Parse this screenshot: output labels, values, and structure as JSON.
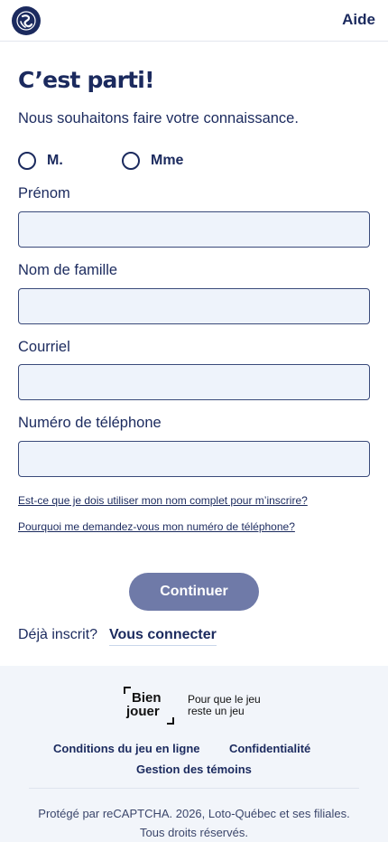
{
  "header": {
    "help_label": "Aide"
  },
  "form": {
    "title": "C’est parti!",
    "subtitle": "Nous souhaitons faire votre connaissance.",
    "salutation": {
      "option_m": "M.",
      "option_mme": "Mme",
      "selected": null
    },
    "fields": {
      "first_name_label": "Prénom",
      "last_name_label": "Nom de famille",
      "email_label": "Courriel",
      "phone_label": "Numéro de téléphone",
      "first_name_value": "",
      "last_name_value": "",
      "email_value": "",
      "phone_value": ""
    },
    "help_full_name": "Est-ce que je dois utiliser mon nom complet pour m’inscrire?",
    "help_phone": "Pourquoi me demandez-vous mon numéro de téléphone?",
    "continue_label": "Continuer",
    "already_registered": "Déjà inscrit?",
    "login_label": "Vous connecter"
  },
  "footer": {
    "brand_line1": "Bien",
    "brand_line2": "jouer",
    "tagline": "Pour que le jeu reste un jeu",
    "links": {
      "conditions": "Conditions du jeu en ligne",
      "privacy": "Confidentialité",
      "cookies": "Gestion des témoins"
    },
    "copyright_line1": "Protégé par reCAPTCHA. 2026, Loto-Québec et ses filiales.",
    "copyright_line2": "Tous droits réservés."
  },
  "colors": {
    "primary": "#1b2a5e",
    "button_disabled": "#6f7aa8",
    "input_bg": "#eef3fb",
    "footer_bg": "#f2f5fa"
  }
}
